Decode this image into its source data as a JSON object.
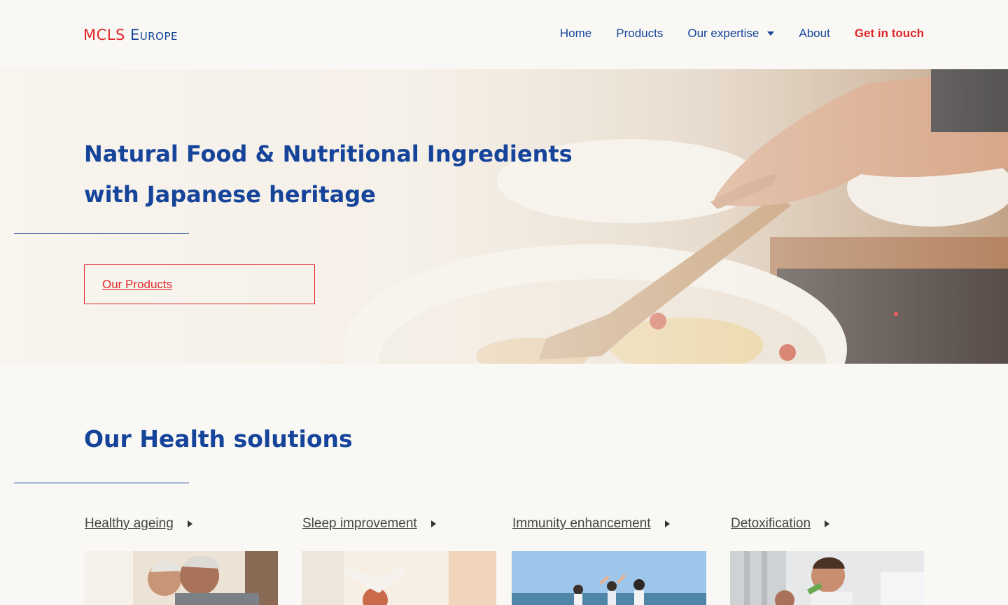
{
  "header": {
    "logo_primary": "MCLS",
    "logo_secondary": "Europe",
    "nav": {
      "home": "Home",
      "products": "Products",
      "expertise": "Our expertise",
      "about": "About",
      "contact": "Get in touch"
    }
  },
  "hero": {
    "title_prefix": "Natural ",
    "title_strong": "Food & Nutritional Ingredients",
    "subtitle": "with Japanese heritage",
    "button_label": "Our Products"
  },
  "health": {
    "title_prefix": "Our ",
    "title_strong": "Health solutions",
    "items": [
      {
        "label": "Healthy ageing"
      },
      {
        "label": "Sleep improvement"
      },
      {
        "label": "Immunity enhancement"
      },
      {
        "label": "Detoxification"
      }
    ]
  },
  "colors": {
    "brand_blue": "#15449a",
    "brand_red": "#e0262a",
    "page_background": "#f9f8f4"
  }
}
